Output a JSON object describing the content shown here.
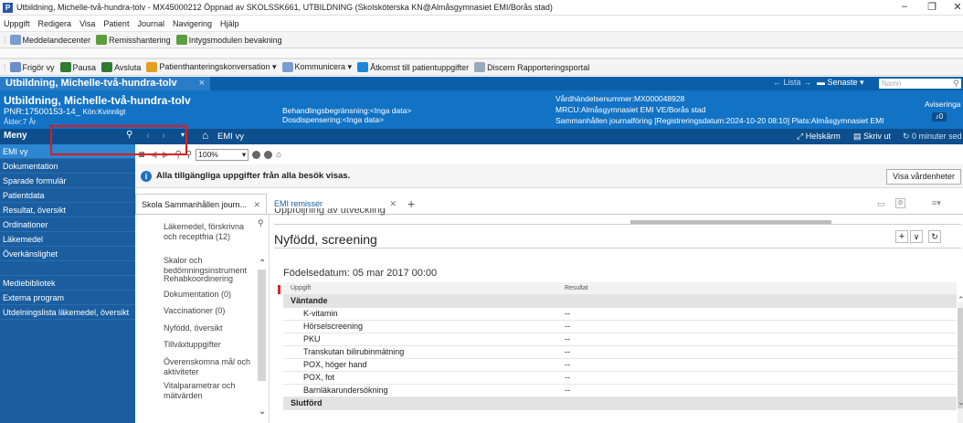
{
  "window": {
    "title": "Utbildning, Michelle-två-hundra-tolv - MX45000212 Öppnad av SKOLSSK661, UTBILDNING (Skolsköterska KN@Almåsgymnasiet EMI/Borås stad)",
    "minimize": "–",
    "restore": "❐",
    "close": "✕"
  },
  "menubar": [
    "Uppgift",
    "Redigera",
    "Visa",
    "Patient",
    "Journal",
    "Navigering",
    "Hjälp"
  ],
  "toolbar1": [
    {
      "label": "Meddelandecenter",
      "color": "#7b9ccf"
    },
    {
      "label": "Remisshantering",
      "color": "#5c9e3f"
    },
    {
      "label": "Intygsmodulen bevakning",
      "color": "#5c9e3f"
    }
  ],
  "toolbar2": [
    {
      "label": "Frigör vy",
      "color": "#6b8fc9"
    },
    {
      "label": "Pausa",
      "color": "#2f7b2f"
    },
    {
      "label": "Avsluta",
      "color": "#2f7b2f"
    },
    {
      "label": "Patienthanteringskonversation ▾",
      "color": "#e0a020"
    },
    {
      "label": "Kommunicera ▾",
      "color": "#7b9ccf"
    },
    {
      "label": "Åtkomst till patientuppgifter",
      "color": "#1e88d8"
    },
    {
      "label": "Discern Rapporteringsportal",
      "color": "#9ab"
    }
  ],
  "patient_tab": {
    "name": "Utbildning, Michelle-två-hundra-tolv",
    "close": "×"
  },
  "banner_nav": {
    "lista": "← Lista →",
    "senaste": "Senaste ▾",
    "search_placeholder": "Namn"
  },
  "banner": {
    "name": "Utbildning, Michelle-två-hundra-tolv",
    "pnr": "PNR:17500153-14_",
    "kon": "Kön:Kvinnligt",
    "alder": "Ålder:7 År",
    "behandling": "Behandlingsbegränsning:<Inga data>",
    "dos": "Dosdispensering:<Inga data>",
    "vardhandelse": "Vårdhändelsenummer:MX000048928",
    "mrcu": "MRCU:Almåsgymnasiet EMI VE/Borås stad",
    "sammanhallen": "Sammanhållen journalföring [Registreringsdatum:2024-10-20 08:10] Plats:Almåsgymnasiet EMI",
    "aviseringar": "Aviseringa",
    "badge": "0"
  },
  "navbar": {
    "menu_label": "Meny",
    "pin": "⚲",
    "back": "‹",
    "forward": "›",
    "home": "⌂",
    "title": "EMI vy",
    "helskarm": "Helskärm",
    "skriv_ut": "Skriv ut",
    "updated": "0 minuter sed"
  },
  "sidebar": [
    {
      "label": "EMI vy",
      "active": true
    },
    {
      "label": "Dokumentation",
      "active": false
    },
    {
      "label": "Sparade formulär",
      "active": false
    },
    {
      "label": "Patientdata",
      "active": false
    },
    {
      "label": "Resultat, översikt",
      "active": false
    },
    {
      "label": "Ordinationer",
      "active": false
    },
    {
      "label": "Läkemedel",
      "active": false
    },
    {
      "label": "Överkänslighet",
      "active": false
    },
    {
      "label": "",
      "active": false
    },
    {
      "label": "Mediebibliotek",
      "active": false
    },
    {
      "label": "Externa program",
      "active": false
    },
    {
      "label": "Utdelningslista läkemedel, översikt",
      "active": false
    }
  ],
  "content_toolbar": {
    "zoom": "100%"
  },
  "info": {
    "message": "Alla tillgängliga uppgifter från alla besök visas.",
    "button": "Visa vårdenheter"
  },
  "tabs": [
    {
      "label": "Skola Sammanhållen journ...",
      "close": "✕"
    },
    {
      "label": "EMI remisser",
      "close": "✕"
    }
  ],
  "add_tab": "+",
  "left_list": [
    {
      "label": "Läkemedel, förskrivna och receptfria (12)"
    },
    {
      "label": "Skalor och bedömningsinstrument"
    },
    {
      "label": "Rehabkoordinering"
    },
    {
      "label": "Dokumentation (0)"
    },
    {
      "label": "Vaccinationer (0)"
    },
    {
      "label": "Nyfödd, översikt"
    },
    {
      "label": "Tillväxtuppgifter"
    },
    {
      "label": "Överenskomna mål och aktiviteter"
    },
    {
      "label": "Vitalparametrar och mätvärden"
    }
  ],
  "section": {
    "cut_title": "Uppföljning av utveckling",
    "title": "Nyfödd, screening",
    "birthdate": "Födelsedatum: 05 mar 2017 00:00"
  },
  "table": {
    "headers": [
      "Uppgift",
      "Resultat"
    ],
    "groups": [
      {
        "label": "Väntande",
        "rows": [
          [
            "K-vitamin",
            "--"
          ],
          [
            "Hörselscreening",
            "--"
          ],
          [
            "PKU",
            "--"
          ],
          [
            "Transkutan bilirubinmätning",
            "--"
          ],
          [
            "POX, höger hand",
            "--"
          ],
          [
            "POX, fot",
            "--"
          ],
          [
            "Barnläkarundersökning",
            "--"
          ]
        ]
      },
      {
        "label": "Slutförd",
        "rows": []
      }
    ]
  }
}
